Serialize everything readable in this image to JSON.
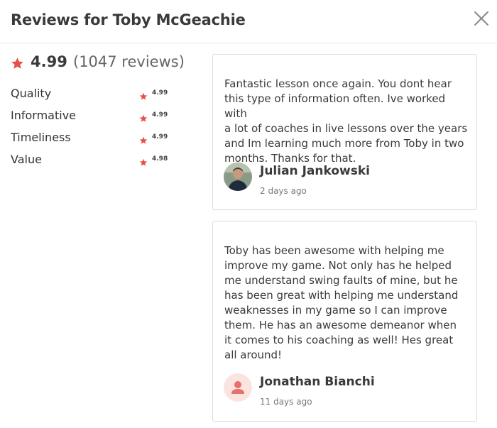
{
  "header": {
    "title": "Reviews for Toby McGeachie",
    "close_icon": "close-icon"
  },
  "summary": {
    "star_icon": "star-icon",
    "star_color": "#e4534a",
    "score": "4.99",
    "count": "(1047 reviews)",
    "metrics": [
      {
        "label": "Quality",
        "value": "4.99"
      },
      {
        "label": "Informative",
        "value": "4.99"
      },
      {
        "label": "Timeliness",
        "value": "4.99"
      },
      {
        "label": "Value",
        "value": "4.98"
      }
    ]
  },
  "reviews": [
    {
      "lines": [
        "Fantastic lesson once again. You dont hear",
        "this type of information often. Ive worked with",
        "a lot of coaches in live lessons over the years",
        "and Im learning much more from Toby in two",
        "months. Thanks for that."
      ],
      "author": "Julian Jankowski",
      "date": "2 days ago",
      "avatar": "user-photo"
    },
    {
      "lines": [
        "Toby has been awesome with helping me",
        "improve my game. Not only has he helped",
        "me understand swing faults of mine, but he",
        "has been great with helping me understand",
        "weaknesses in my game so I can improve",
        "them. He has an awesome demeanor when",
        "it comes to his coaching as well! Hes great",
        "all around!"
      ],
      "author": "Jonathan Bianchi",
      "date": "11 days ago",
      "avatar": "default-user-icon"
    }
  ]
}
